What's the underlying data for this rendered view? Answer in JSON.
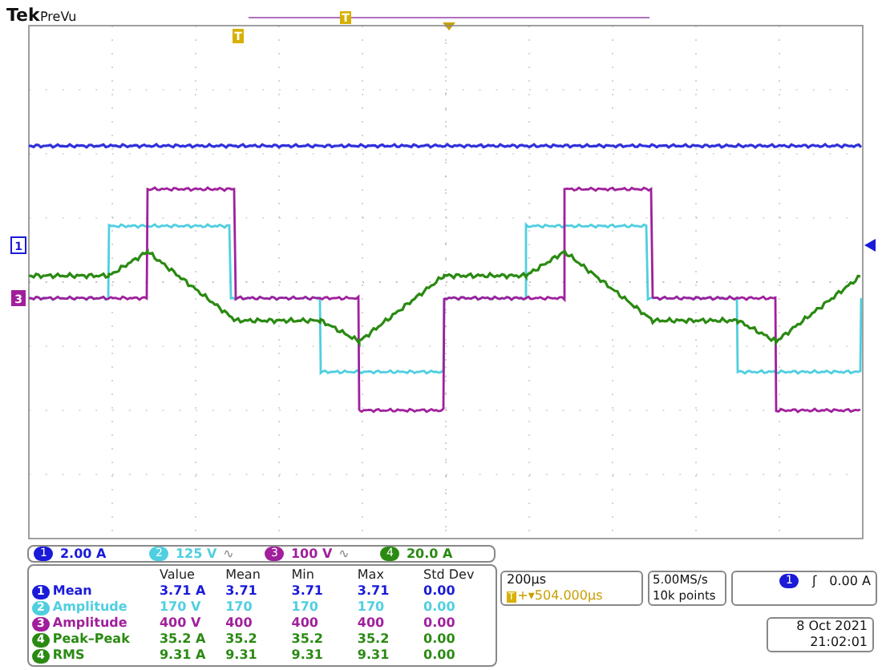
{
  "brand": {
    "logo": "Tek",
    "mode": "PreVu"
  },
  "markers": {
    "trigger_position": "T",
    "trigger_time": "T",
    "ground_1": "1",
    "ground_3": "3"
  },
  "channels": [
    {
      "number": "1",
      "scale": "2.00 A",
      "color": "#1a1ad8"
    },
    {
      "number": "2",
      "scale": "125 V",
      "bandwidth": "∿",
      "color": "#4fcfe0"
    },
    {
      "number": "3",
      "scale": "100 V",
      "bandwidth": "∿",
      "color": "#a0209c"
    },
    {
      "number": "4",
      "scale": "20.0 A",
      "color": "#2a8a12"
    }
  ],
  "measurements": {
    "columns": [
      "Value",
      "Mean",
      "Min",
      "Max",
      "Std Dev"
    ],
    "rows": [
      {
        "source": "1",
        "color": "#1a1ad8",
        "type": "Mean",
        "values": [
          "3.71 A",
          "3.71",
          "3.71",
          "3.71",
          "0.00"
        ]
      },
      {
        "source": "2",
        "color": "#4fcfe0",
        "type": "Amplitude",
        "values": [
          "170 V",
          "170",
          "170",
          "170",
          "0.00"
        ]
      },
      {
        "source": "3",
        "color": "#a0209c",
        "type": "Amplitude",
        "values": [
          "400 V",
          "400",
          "400",
          "400",
          "0.00"
        ]
      },
      {
        "source": "4",
        "color": "#2a8a12",
        "type": "Peak–Peak",
        "values": [
          "35.2 A",
          "35.2",
          "35.2",
          "35.2",
          "0.00"
        ]
      },
      {
        "source": "4",
        "color": "#2a8a12",
        "type": "RMS",
        "values": [
          "9.31 A",
          "9.31",
          "9.31",
          "9.31",
          "0.00"
        ]
      }
    ]
  },
  "timebase": {
    "scale": "200µs",
    "marker": "T",
    "delay": "+▾504.000µs"
  },
  "acquisition": {
    "rate": "5.00MS/s",
    "points": "10k points"
  },
  "trigger": {
    "source": "1",
    "slope": "ʃ",
    "level": "0.00 A"
  },
  "datetime": {
    "date": "8 Oct  2021",
    "time": "21:02:01"
  }
}
